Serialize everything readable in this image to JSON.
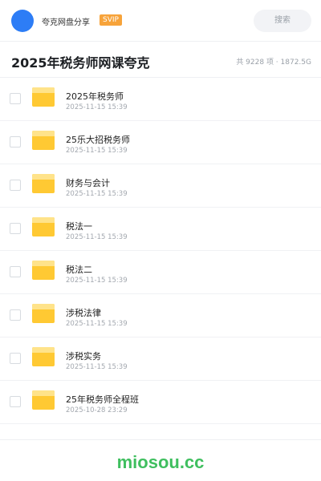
{
  "topbar": {
    "sharer_name": "夸克网盘分享",
    "badge": "SVIP",
    "search_placeholder": "搜索",
    "avatar_color": "#2d7df6"
  },
  "header": {
    "title": "2025年税务师网课夸克",
    "meta": "共 9228 项 · 1872.5G"
  },
  "files": [
    {
      "name": "2025年税务师",
      "date": "2025-11-15 15:39",
      "icon": "folder-icon"
    },
    {
      "name": "25乐大招税务师",
      "date": "2025-11-15 15:39",
      "icon": "folder-icon"
    },
    {
      "name": "财务与会计",
      "date": "2025-11-15 15:39",
      "icon": "folder-icon"
    },
    {
      "name": "税法一",
      "date": "2025-11-15 15:39",
      "icon": "folder-icon"
    },
    {
      "name": "税法二",
      "date": "2025-11-15 15:39",
      "icon": "folder-icon"
    },
    {
      "name": "涉税法律",
      "date": "2025-11-15 15:39",
      "icon": "folder-icon"
    },
    {
      "name": "涉税实务",
      "date": "2025-11-15 15:39",
      "icon": "folder-icon"
    },
    {
      "name": "25年税务师全程班",
      "date": "2025-10-28 23:29",
      "icon": "folder-icon"
    }
  ],
  "footer": {
    "brand": "miosou.cc",
    "brand_color": "#3fbf5f"
  },
  "colors": {
    "folder": "#ffc933",
    "badge": "#f7a33a"
  }
}
